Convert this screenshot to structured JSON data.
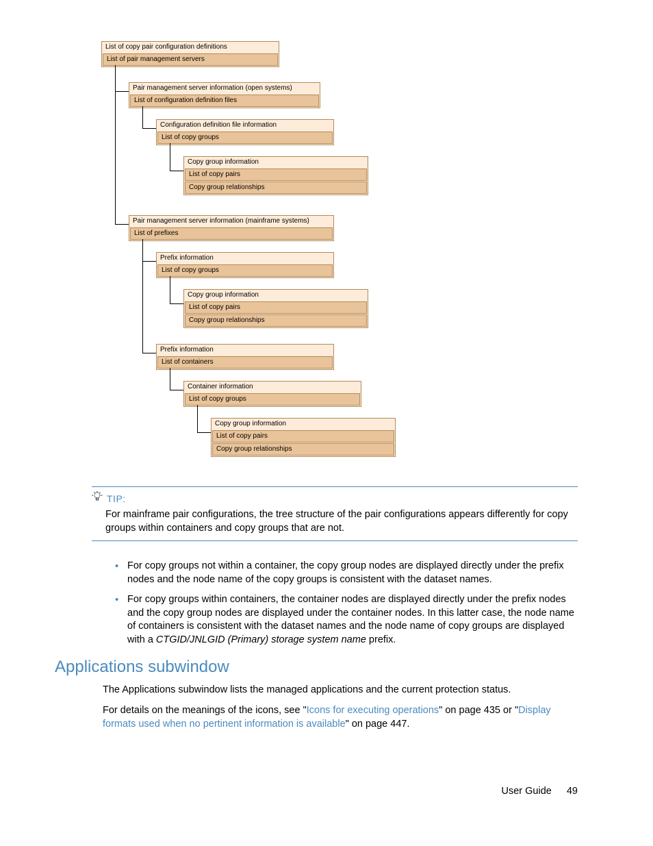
{
  "diagram": {
    "root": {
      "title": "List of copy pair configuration definitions",
      "child": "List of pair management servers"
    },
    "open": {
      "title": "Pair management server information (open systems)",
      "child": "List of configuration definition files",
      "cfg": {
        "title": "Configuration definition file information",
        "child": "List of copy groups"
      },
      "cg": {
        "title": "Copy group information",
        "child1": "List of copy pairs",
        "child2": "Copy group relationships"
      }
    },
    "mf": {
      "title": "Pair management server information (mainframe systems)",
      "child": "List of prefixes",
      "pfx1": {
        "title": "Prefix information",
        "child": "List of copy groups"
      },
      "cg1": {
        "title": "Copy group information",
        "child1": "List of copy pairs",
        "child2": "Copy group relationships"
      },
      "pfx2": {
        "title": "Prefix information",
        "child": "List of containers"
      },
      "cont": {
        "title": "Container information",
        "child": "List of copy groups"
      },
      "cg2": {
        "title": "Copy group information",
        "child1": "List of copy pairs",
        "child2": "Copy group relationships"
      }
    }
  },
  "tip": {
    "label": "TIP:",
    "body": "For mainframe pair configurations, the tree structure of the pair configurations appears differently for copy groups within containers and copy groups that are not."
  },
  "bullets": {
    "b1": "For copy groups not within a container, the copy group nodes are displayed directly under the prefix nodes and the node name of the copy groups is consistent with the dataset names.",
    "b2a": "For copy groups within containers, the container nodes are displayed directly under the prefix nodes and the copy group nodes are displayed under the container nodes. In this latter case, the node name of containers is consistent with the dataset names and the node name of copy groups are displayed with a ",
    "b2i": "CTGID/JNLGID (Primary) storage system name",
    "b2b": " prefix."
  },
  "heading": "Applications subwindow",
  "p1": "The Applications subwindow lists the managed applications and the current protection status.",
  "p2": {
    "a": "For details on the meanings of the icons, see \"",
    "link1": "Icons for executing operations",
    "b": "\" on page 435 or \"",
    "link2": "Display formats used when no pertinent information is available",
    "c": "\" on page 447."
  },
  "footer": {
    "label": "User Guide",
    "page": "49"
  }
}
